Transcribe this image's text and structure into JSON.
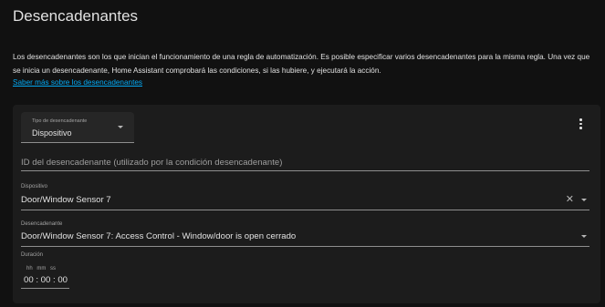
{
  "page": {
    "title": "Desencadenantes",
    "description": "Los desencadenantes son los que inician el funcionamiento de una regla de automatización. Es posible especificar varios desencadenantes para la misma regla. Una vez que se inicia un desencadenante, Home Assistant comprobará las condiciones, si las hubiere, y ejecutará la acción.",
    "learn_more_link": "Saber más sobre los desencadenantes"
  },
  "trigger_card": {
    "type_select": {
      "label": "Tipo de desencadenante",
      "value": "Dispositivo"
    },
    "trigger_id_field": {
      "placeholder": "ID del desencadenante (utilizado por la condición desencadenante)"
    },
    "device_field": {
      "label": "Dispositivo",
      "value": "Door/Window Sensor 7"
    },
    "trigger_field": {
      "label": "Desencadenante",
      "value": "Door/Window Sensor 7: Access Control - Window/door is open cerrado"
    },
    "duration": {
      "label": "Duración",
      "units": "hh mm ss",
      "value": "00 : 00 : 00"
    }
  },
  "icons": {
    "menu": "kebab-menu-icon",
    "clear": "close-icon",
    "dropdown": "chevron-down-icon"
  },
  "colors": {
    "background": "#111111",
    "card": "#1c1c1c",
    "link": "#03a9f4",
    "text": "#e1e1e1"
  }
}
